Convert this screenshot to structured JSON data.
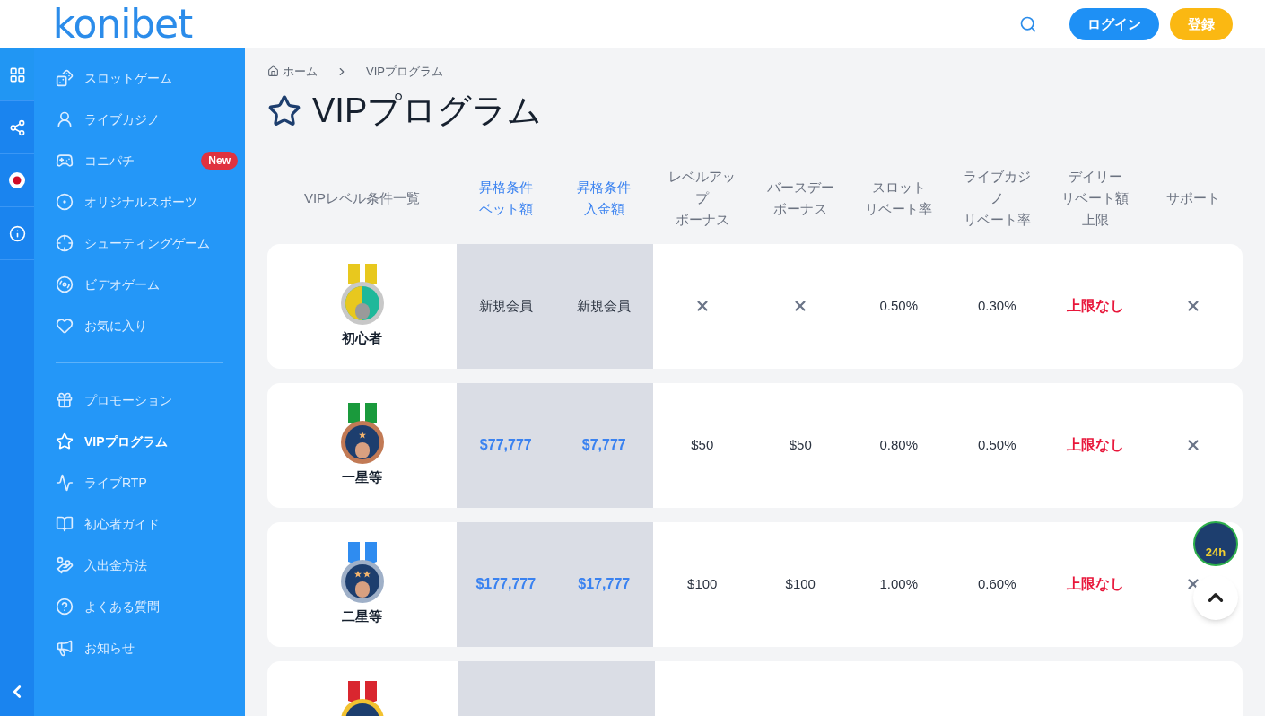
{
  "header": {
    "logo": "konibet",
    "login": "ログイン",
    "register": "登録"
  },
  "rail": [
    {
      "selected": true
    },
    {
      "selected": false
    },
    {
      "selected": false
    },
    {
      "selected": false
    }
  ],
  "sidebar": {
    "groups": [
      [
        {
          "label": "スロットゲーム",
          "selected": false
        },
        {
          "label": "ライブカジノ",
          "selected": false
        },
        {
          "label": "コニパチ",
          "selected": false,
          "badge": "New"
        },
        {
          "label": "オリジナルスポーツ",
          "selected": false
        },
        {
          "label": "シューティングゲーム",
          "selected": false
        },
        {
          "label": "ビデオゲーム",
          "selected": false
        },
        {
          "label": "お気に入り",
          "selected": false
        }
      ],
      [
        {
          "label": "プロモーション",
          "selected": false
        },
        {
          "label": "VIPプログラム",
          "selected": true
        },
        {
          "label": "ライブRTP",
          "selected": false
        },
        {
          "label": "初心者ガイド",
          "selected": false
        },
        {
          "label": "入出金方法",
          "selected": false
        },
        {
          "label": "よくある質問",
          "selected": false
        },
        {
          "label": "お知らせ",
          "selected": false
        }
      ]
    ]
  },
  "breadcrumb": [
    "ホーム",
    "VIPプログラム"
  ],
  "title": "VIPプログラム",
  "table": {
    "columns": [
      {
        "lines": [
          "VIPレベル条件一覧"
        ],
        "kind": "plain"
      },
      {
        "lines": [
          "昇格条件",
          "ベット額"
        ],
        "kind": "link"
      },
      {
        "lines": [
          "昇格条件",
          "入金額"
        ],
        "kind": "link"
      },
      {
        "lines": [
          "レベルアッ",
          "プ",
          "ボーナス"
        ],
        "kind": "plain"
      },
      {
        "lines": [
          "バースデー",
          "ボーナス"
        ],
        "kind": "plain"
      },
      {
        "lines": [
          "スロット",
          "リベート率"
        ],
        "kind": "plain"
      },
      {
        "lines": [
          "ライブカジ",
          "ノ",
          "リベート率"
        ],
        "kind": "plain"
      },
      {
        "lines": [
          "デイリー",
          "リベート額",
          "上限"
        ],
        "kind": "plain"
      },
      {
        "lines": [
          "サポート"
        ],
        "kind": "plain"
      }
    ],
    "rows": [
      {
        "color": "#e8c81e",
        "kind": "beginner",
        "cells": [
          {
            "kind": "level",
            "text": "初心者"
          },
          {
            "kind": "text",
            "text": "新規会員"
          },
          {
            "kind": "text",
            "text": "新規会員"
          },
          {
            "kind": "none"
          },
          {
            "kind": "none"
          },
          {
            "kind": "text",
            "text": "0.50%"
          },
          {
            "kind": "text",
            "text": "0.30%"
          },
          {
            "kind": "alert",
            "text": "上限なし"
          },
          {
            "kind": "none"
          }
        ]
      },
      {
        "color": "#1a9a3c",
        "kind": "one_star",
        "cells": [
          {
            "kind": "level",
            "text": "一星等"
          },
          {
            "kind": "link",
            "text": "$77,777"
          },
          {
            "kind": "link",
            "text": "$7,777"
          },
          {
            "kind": "text",
            "text": "$50"
          },
          {
            "kind": "text",
            "text": "$50"
          },
          {
            "kind": "text",
            "text": "0.80%"
          },
          {
            "kind": "text",
            "text": "0.50%"
          },
          {
            "kind": "alert",
            "text": "上限なし"
          },
          {
            "kind": "none"
          }
        ]
      },
      {
        "color": "#2f8cf0",
        "kind": "two_star",
        "cells": [
          {
            "kind": "level",
            "text": "二星等"
          },
          {
            "kind": "link",
            "text": "$177,777"
          },
          {
            "kind": "link",
            "text": "$17,777"
          },
          {
            "kind": "text",
            "text": "$100"
          },
          {
            "kind": "text",
            "text": "$100"
          },
          {
            "kind": "text",
            "text": "1.00%"
          },
          {
            "kind": "text",
            "text": "0.60%"
          },
          {
            "kind": "alert",
            "text": "上限なし"
          },
          {
            "kind": "none"
          }
        ]
      },
      {
        "color": "#d9262f",
        "kind": "gold"
      }
    ]
  },
  "support_badge": "24h"
}
